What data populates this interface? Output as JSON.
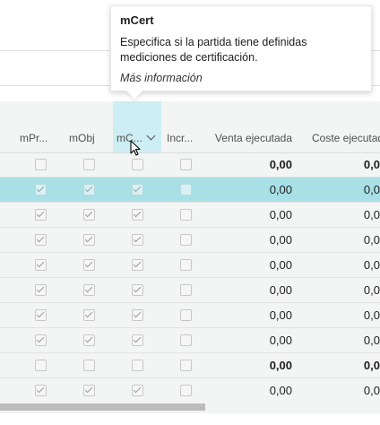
{
  "columns": {
    "mpr": "mPr...",
    "mobj": "mObj",
    "mcert": "mC...",
    "incr": "Incr...",
    "venta": "Venta ejecutada",
    "coste": "Coste ejecutado"
  },
  "tooltip": {
    "title": "mCert",
    "description_line1": "Especifica si la partida tiene definidas",
    "description_line2": "mediciones de certificación.",
    "link": "Más información"
  },
  "rows": [
    {
      "mpr": false,
      "mobj": false,
      "mcert": false,
      "incr": false,
      "venta": "0,00",
      "coste": "0,0",
      "bold": true,
      "selected": false
    },
    {
      "mpr": true,
      "mobj": true,
      "mcert": true,
      "incr": false,
      "venta": "0,00",
      "coste": "0,0",
      "bold": false,
      "selected": true
    },
    {
      "mpr": true,
      "mobj": true,
      "mcert": true,
      "incr": false,
      "venta": "0,00",
      "coste": "0,0",
      "bold": false,
      "selected": false
    },
    {
      "mpr": true,
      "mobj": true,
      "mcert": true,
      "incr": false,
      "venta": "0,00",
      "coste": "0,0",
      "bold": false,
      "selected": false
    },
    {
      "mpr": true,
      "mobj": true,
      "mcert": true,
      "incr": false,
      "venta": "0,00",
      "coste": "0,0",
      "bold": false,
      "selected": false
    },
    {
      "mpr": true,
      "mobj": true,
      "mcert": true,
      "incr": false,
      "venta": "0,00",
      "coste": "0,0",
      "bold": false,
      "selected": false
    },
    {
      "mpr": true,
      "mobj": true,
      "mcert": true,
      "incr": false,
      "venta": "0,00",
      "coste": "0,0",
      "bold": false,
      "selected": false
    },
    {
      "mpr": true,
      "mobj": true,
      "mcert": true,
      "incr": false,
      "venta": "0,00",
      "coste": "0,0",
      "bold": false,
      "selected": false
    },
    {
      "mpr": false,
      "mobj": false,
      "mcert": false,
      "incr": false,
      "venta": "0,00",
      "coste": "0,0",
      "bold": true,
      "selected": false
    },
    {
      "mpr": true,
      "mobj": true,
      "mcert": true,
      "incr": false,
      "venta": "0,00",
      "coste": "0,0",
      "bold": false,
      "selected": false
    }
  ],
  "colors": {
    "selected_row": "#a8e0e6",
    "active_column_header": "#cdeef2",
    "grid_background": "#f3f4f4"
  }
}
